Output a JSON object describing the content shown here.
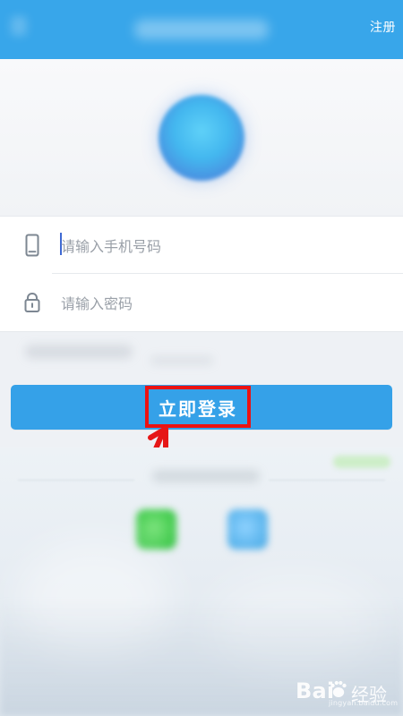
{
  "header": {
    "register_label": "注册"
  },
  "form": {
    "phone_placeholder": "请输入手机号码",
    "password_placeholder": "请输入密码"
  },
  "login_button": {
    "label": "立即登录"
  },
  "watermark": {
    "text_left": "Bai",
    "text_right": "经验",
    "url": "jingyan.baidu.com"
  },
  "icons": {
    "phone": "mobile-phone-icon",
    "password": "lock-icon",
    "annotation": "red-arrow-icon",
    "brand": "paw-icon"
  },
  "colors": {
    "header": "#38a6ea",
    "button": "#35a1e8",
    "highlight": "#eb1212",
    "placeholder": "#9aa0a8"
  }
}
